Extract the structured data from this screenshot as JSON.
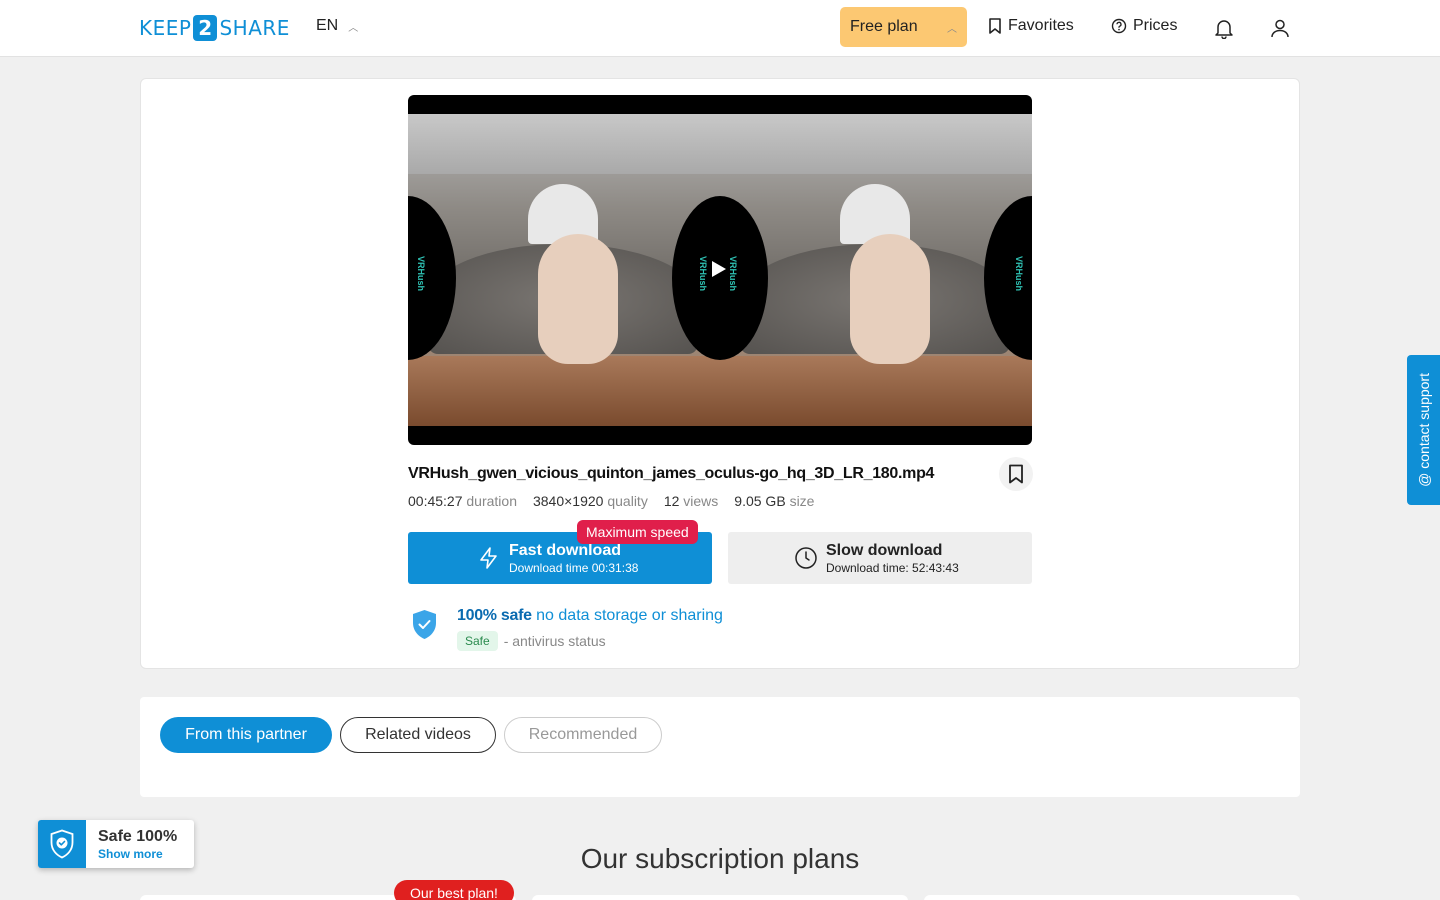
{
  "header": {
    "logo_left": "KEEP",
    "logo_mid": "2",
    "logo_right": "SHARE",
    "lang": "EN",
    "plan_label": "Free plan",
    "favorites_label": "Favorites",
    "prices_label": "Prices"
  },
  "file": {
    "name": "VRHush_gwen_vicious_quinton_james_oculus-go_hq_3D_LR_180.mp4",
    "duration_value": "00:45:27",
    "duration_label": "duration",
    "quality_value": "3840×1920",
    "quality_label": "quality",
    "views_value": "12",
    "views_label": "views",
    "size_value": "9.05 GB",
    "size_label": "size",
    "watermark": "VRHush"
  },
  "downloads": {
    "badge": "Maximum speed",
    "fast_title": "Fast download",
    "fast_sub": "Download time 00:31:38",
    "slow_title": "Slow download",
    "slow_sub": "Download time: 52:43:43"
  },
  "safety": {
    "bold": "100% safe",
    "rest": "no data storage or sharing",
    "chip": "Safe",
    "status": "- antivirus status"
  },
  "tabs": [
    {
      "label": "From this partner"
    },
    {
      "label": "Related videos"
    },
    {
      "label": "Recommended"
    }
  ],
  "plans": {
    "title": "Our subscription plans",
    "best_badge": "Our best plan!"
  },
  "support_label": "contact support",
  "safe_widget": {
    "title": "Safe 100%",
    "link": "Show more"
  },
  "colors": {
    "accent": "#0f8fd6",
    "plan_button": "#fcc872",
    "badge_red": "#e01f4b"
  }
}
